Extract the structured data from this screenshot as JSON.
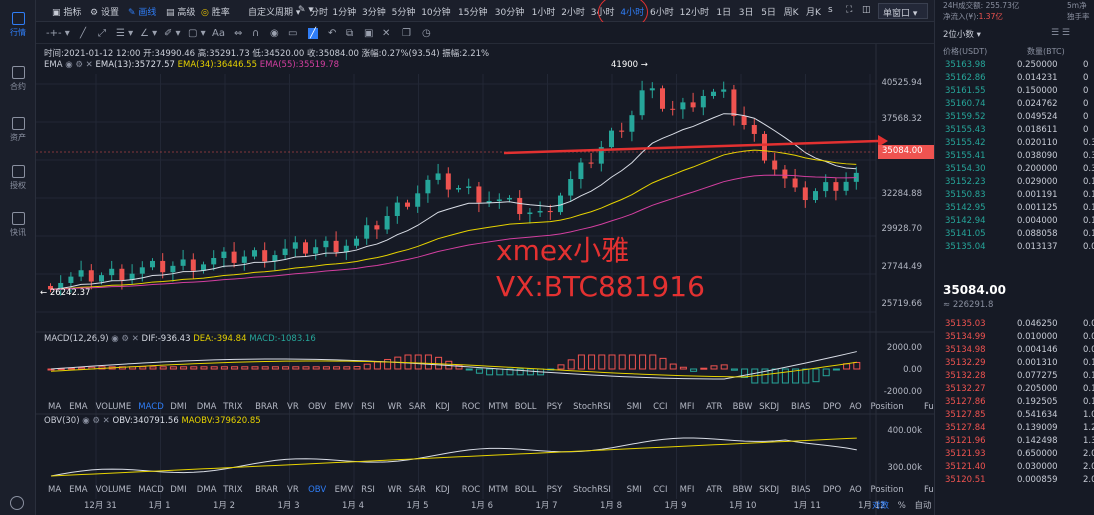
{
  "nav": [
    {
      "label": "行情",
      "icon": "chart-icon",
      "active": true
    },
    {
      "label": "合约",
      "icon": "contract-icon",
      "active": false
    },
    {
      "label": "资产",
      "icon": "wallet-icon",
      "active": false
    },
    {
      "label": "授权",
      "icon": "key-icon",
      "active": false
    },
    {
      "label": "快讯",
      "icon": "news-icon",
      "active": false
    }
  ],
  "toolbar": {
    "indicator": "指标",
    "settings": "设置",
    "tab_line": "画线",
    "tab_advanced": "高级",
    "tab_winrate": "胜率",
    "custom_period": "自定义周期",
    "single_window": "单窗口"
  },
  "timeframes": [
    "分时",
    "1分钟",
    "3分钟",
    "5分钟",
    "10分钟",
    "15分钟",
    "30分钟",
    "1小时",
    "2小时",
    "3小时",
    "4小时",
    "6小时",
    "12小时",
    "1日",
    "3日",
    "5日",
    "周K",
    "月K",
    "s"
  ],
  "active_timeframe": "4小时",
  "info": {
    "time": "时间:2021-01-12 12:00",
    "open": "开:34990.46",
    "high": "高:35291.73",
    "low": "低:34520.00",
    "close": "收:35084.00",
    "change": "涨幅:0.27%(93.54)",
    "amplitude": "振幅:2.21%"
  },
  "ema": {
    "label": "EMA",
    "ema13": "EMA(13):35727.57",
    "ema34": "EMA(34):36446.55",
    "ema55": "EMA(55):35519.78"
  },
  "price_axis": [
    "40525.94",
    "37568.32",
    "32284.88",
    "29928.70",
    "27744.49",
    "25719.66"
  ],
  "current_price": "35084.00",
  "peak_label": "41900 →",
  "low_label": "← 26242.37",
  "watermark": {
    "line1": "xmex小雅",
    "line2": "VX:BTC881916"
  },
  "macd": {
    "title": "MACD(12,26,9)",
    "dif": "DIF:-936.43",
    "dea": "DEA:-394.84",
    "macd": "MACD:-1083.16",
    "axis": [
      "2000.00",
      "0.00",
      "-2000.00"
    ]
  },
  "indicators": [
    "MA",
    "EMA",
    "VOLUME",
    "MACD",
    "DMI",
    "DMA",
    "TRIX",
    "BRAR",
    "VR",
    "OBV",
    "EMV",
    "RSI",
    "WR",
    "SAR",
    "KDJ",
    "ROC",
    "MTM",
    "BOLL",
    "PSY",
    "StochRSI",
    "SMI",
    "CCI",
    "MFI",
    "ATR",
    "BBW",
    "SKDJ",
    "BIAS",
    "DPO",
    "AO",
    "Position",
    "Fundflow"
  ],
  "obv": {
    "title": "OBV(30)",
    "obv": "OBV:340791.56",
    "maobv": "MAOBV:379620.85",
    "axis": [
      "400.00k",
      "300.00k"
    ]
  },
  "dates": [
    "12月 31",
    "1月 1",
    "1月 2",
    "1月 3",
    "1月 4",
    "1月 5",
    "1月 6",
    "1月 7",
    "1月 8",
    "1月 9",
    "1月 10",
    "1月 11",
    "1月 12"
  ],
  "bottom_controls": [
    "对数",
    "%",
    "自动"
  ],
  "right": {
    "vol24": "24H成交额: 255.73亿",
    "net_inflow_label": "净流入(¥):",
    "net_inflow": "1.37亿",
    "tag1": "5m净",
    "tag2": "独手率",
    "decimals": "2位小数",
    "col_price": "价格(USDT)",
    "col_qty": "数量(BTC)",
    "mid_price": "35084.00",
    "mid_sub": "≈ 226291.8",
    "asks": [
      [
        "35163.98",
        "0.250000",
        "0"
      ],
      [
        "35162.86",
        "0.014231",
        "0"
      ],
      [
        "35161.55",
        "0.150000",
        "0"
      ],
      [
        "35160.74",
        "0.024762",
        "0"
      ],
      [
        "35159.52",
        "0.049524",
        "0"
      ],
      [
        "35155.43",
        "0.018611",
        "0"
      ],
      [
        "35155.42",
        "0.020110",
        "0.3"
      ],
      [
        "35155.41",
        "0.038090",
        "0.3"
      ],
      [
        "35154.30",
        "0.200000",
        "0.3"
      ],
      [
        "35152.23",
        "0.029000",
        "0.1"
      ],
      [
        "35150.83",
        "0.001191",
        "0.1"
      ],
      [
        "35142.95",
        "0.001125",
        "0.1"
      ],
      [
        "35142.94",
        "0.004000",
        "0.1"
      ],
      [
        "35141.05",
        "0.088058",
        "0.1"
      ],
      [
        "35135.04",
        "0.013137",
        "0.0"
      ]
    ],
    "bids": [
      [
        "35135.03",
        "0.046250",
        "0.0"
      ],
      [
        "35134.99",
        "0.010000",
        "0.0"
      ],
      [
        "35134.98",
        "0.004146",
        "0.0"
      ],
      [
        "35132.29",
        "0.001310",
        "0.1"
      ],
      [
        "35132.28",
        "0.077275",
        "0.1"
      ],
      [
        "35132.27",
        "0.205000",
        "0.1"
      ],
      [
        "35127.86",
        "0.192505",
        "0.1"
      ],
      [
        "35127.85",
        "0.541634",
        "1.0"
      ],
      [
        "35127.84",
        "0.139009",
        "1.2"
      ],
      [
        "35121.96",
        "0.142498",
        "1.3"
      ],
      [
        "35121.93",
        "0.650000",
        "2.0"
      ],
      [
        "35121.40",
        "0.030000",
        "2.0"
      ],
      [
        "35120.51",
        "0.000859",
        "2.0"
      ]
    ]
  },
  "colors": {
    "up": "#26a69a",
    "down": "#ef5350",
    "accent": "#2f7df6",
    "ema13": "#d9dde6",
    "ema34": "#e6d200",
    "ema55": "#d33fa0"
  }
}
